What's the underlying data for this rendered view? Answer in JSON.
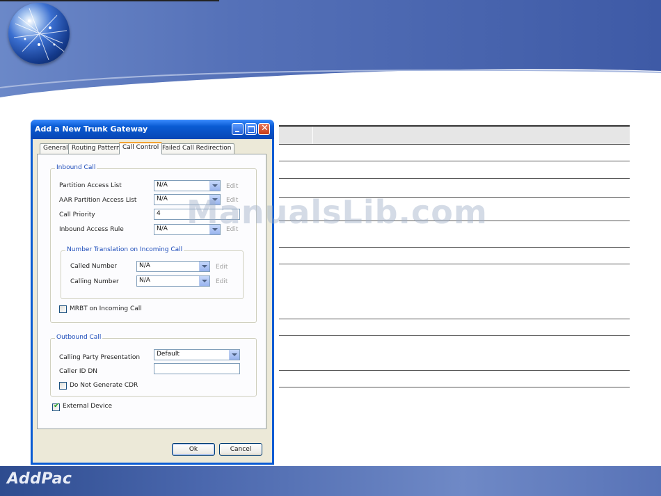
{
  "slide": {
    "footer_logo": "AddPac",
    "watermark": "ManualsLib.com"
  },
  "dialog": {
    "title": "Add a New Trunk Gateway",
    "tabs": [
      {
        "label": "General",
        "active": false
      },
      {
        "label": "Routing Pattern",
        "active": false
      },
      {
        "label": "Call Control",
        "active": true
      },
      {
        "label": "Failed Call Redirection",
        "active": false
      }
    ],
    "inbound": {
      "title": "Inbound Call",
      "partition_access_list": {
        "label": "Partition Access List",
        "value": "N/A",
        "edit": "Edit"
      },
      "aar_partition_access_list": {
        "label": "AAR Partition Access List",
        "value": "N/A",
        "edit": "Edit"
      },
      "call_priority": {
        "label": "Call Priority",
        "value": "4"
      },
      "inbound_access_rule": {
        "label": "Inbound Access Rule",
        "value": "N/A",
        "edit": "Edit"
      },
      "number_translation": {
        "title": "Number Translation on Incoming Call",
        "called_number": {
          "label": "Called Number",
          "value": "N/A",
          "edit": "Edit"
        },
        "calling_number": {
          "label": "Calling Number",
          "value": "N/A",
          "edit": "Edit"
        }
      },
      "mrbt": {
        "label": "MRBT on Incoming Call",
        "checked": false
      }
    },
    "outbound": {
      "title": "Outbound Call",
      "calling_party_presentation": {
        "label": "Calling Party Presentation",
        "value": "Default"
      },
      "caller_id_dn": {
        "label": "Caller ID DN",
        "value": ""
      },
      "do_not_generate_cdr": {
        "label": "Do Not Generate CDR",
        "checked": false
      }
    },
    "external_device": {
      "label": "External Device",
      "checked": true
    },
    "buttons": {
      "ok": "Ok",
      "cancel": "Cancel"
    }
  }
}
